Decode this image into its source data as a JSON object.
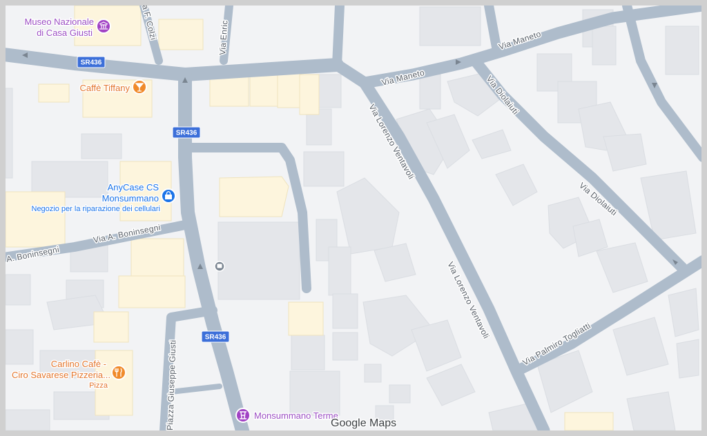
{
  "map": {
    "roads": {
      "sr436": "SR436",
      "via_maneto_1": "Via Maneto",
      "via_maneto_2": "Via Maneto",
      "via_ventavoli_1": "Via Lorenzo Ventavoli",
      "via_ventavoli_2": "Via Lorenzo Ventavoli",
      "via_diolaiuti_1": "Via Diolaiuti",
      "via_diolaiuti_2": "Via Diolaiuti",
      "via_boninsegni_1": "A. Boninsegni",
      "via_boninsegni_2": "Via A. Boninsegni",
      "via_togliatti": "Via Palmiro Togliatti",
      "piazza_giusti": "Piazza Giuseppe Giusti",
      "via_colzi": "a F. Colzi",
      "via_enrico": "Via Enric"
    },
    "pois": {
      "museo": {
        "line1": "Museo Nazionale",
        "line2": "di Casa Giusti",
        "icon": "museum-icon",
        "color": "#a142c4"
      },
      "caffe_tiffany": {
        "name": "Caffè Tiffany",
        "icon": "cocktail-icon",
        "color": "#f08a2a"
      },
      "anycase": {
        "line1": "AnyCase CS",
        "line2": "Monsummano",
        "subtitle": "Negozio per la riparazione dei cellulari",
        "icon": "shopping-bag-icon",
        "color": "#1a73e8"
      },
      "carlino": {
        "line1": "Carlino Cafè -",
        "line2": "Ciro Savarese Pizzeria...",
        "subtitle": "Pizza",
        "icon": "restaurant-icon",
        "color": "#f08a2a"
      },
      "monsummano_terme": {
        "name": "Monsummano Terme",
        "icon": "landmark-icon",
        "color": "#a142c4"
      }
    },
    "bus_stop_icon": "bus-stop-icon",
    "watermark": "Google Maps"
  }
}
